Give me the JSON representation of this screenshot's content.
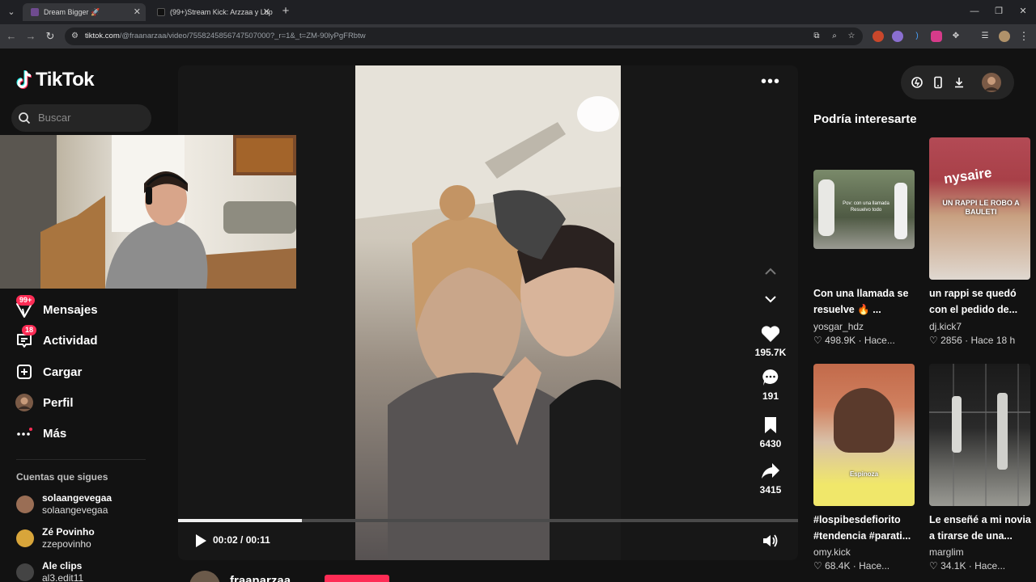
{
  "browser": {
    "tabs": [
      {
        "title": "Dream Bigger 🚀",
        "active": true,
        "favicon_color": "#6f4b8f"
      },
      {
        "title": "(99+)Stream Kick: Arzzaa y Lup",
        "active": false,
        "favicon_color": "#111111"
      }
    ],
    "url": {
      "host": "tiktok.com",
      "path": "/@fraanarzaa/video/7558245856747507000?_r=1&_t=ZM-90lyPgFRbtw"
    }
  },
  "sidebar": {
    "logo_text": "TikTok",
    "search_placeholder": "Buscar",
    "nav": [
      {
        "label": "Mensajes",
        "icon": "messages-icon",
        "badge": "99+"
      },
      {
        "label": "Actividad",
        "icon": "activity-icon",
        "badge": "18"
      },
      {
        "label": "Cargar",
        "icon": "upload-icon",
        "badge": ""
      },
      {
        "label": "Perfil",
        "icon": "profile-icon",
        "badge": ""
      },
      {
        "label": "Más",
        "icon": "more-icon",
        "badge": ""
      }
    ],
    "following_title": "Cuentas que sigues",
    "following": [
      {
        "name": "solaangevegaa",
        "handle": "solaangevegaa"
      },
      {
        "name": "Zé Povinho",
        "handle": "zzepovinho"
      },
      {
        "name": "Ale clips",
        "handle": "al3.edit11"
      }
    ]
  },
  "player": {
    "current_time": "00:02",
    "duration": "00:11",
    "time_separator": " / ",
    "progress_fraction": 0.2,
    "actions": [
      {
        "icon": "heart-icon",
        "count": "195.7K"
      },
      {
        "icon": "comment-icon",
        "count": "191"
      },
      {
        "icon": "bookmark-icon",
        "count": "6430"
      },
      {
        "icon": "share-icon",
        "count": "3415"
      }
    ],
    "author": "fraanarzaa"
  },
  "recommendations": {
    "title": "Podría interesarte",
    "items": [
      {
        "title_line1": "Con una llamada se",
        "title_line2": "resuelve 🔥 ...",
        "user": "yosgar_hdz",
        "likes": "498.9K",
        "when": "Hace...",
        "thumb_caption": "Pov: con una llamada Resuelvo todo"
      },
      {
        "title_line1": "un rappi se quedó",
        "title_line2": "con el pedido de...",
        "user": "dj.kick7",
        "likes": "2856",
        "when": "Hace 18 h",
        "thumb_caption": "UN RAPPI LE ROBO A BAULETI"
      },
      {
        "title_line1": "#lospibesdefiorito",
        "title_line2": "#tendencia #parati...",
        "user": "omy.kick",
        "likes": "68.4K",
        "when": "Hace...",
        "thumb_caption": "Espinoza"
      },
      {
        "title_line1": "Le enseñé a mi novia",
        "title_line2": "a tirarse de una...",
        "user": "marglim",
        "likes": "34.1K",
        "when": "Hace...",
        "thumb_caption": ""
      }
    ]
  }
}
